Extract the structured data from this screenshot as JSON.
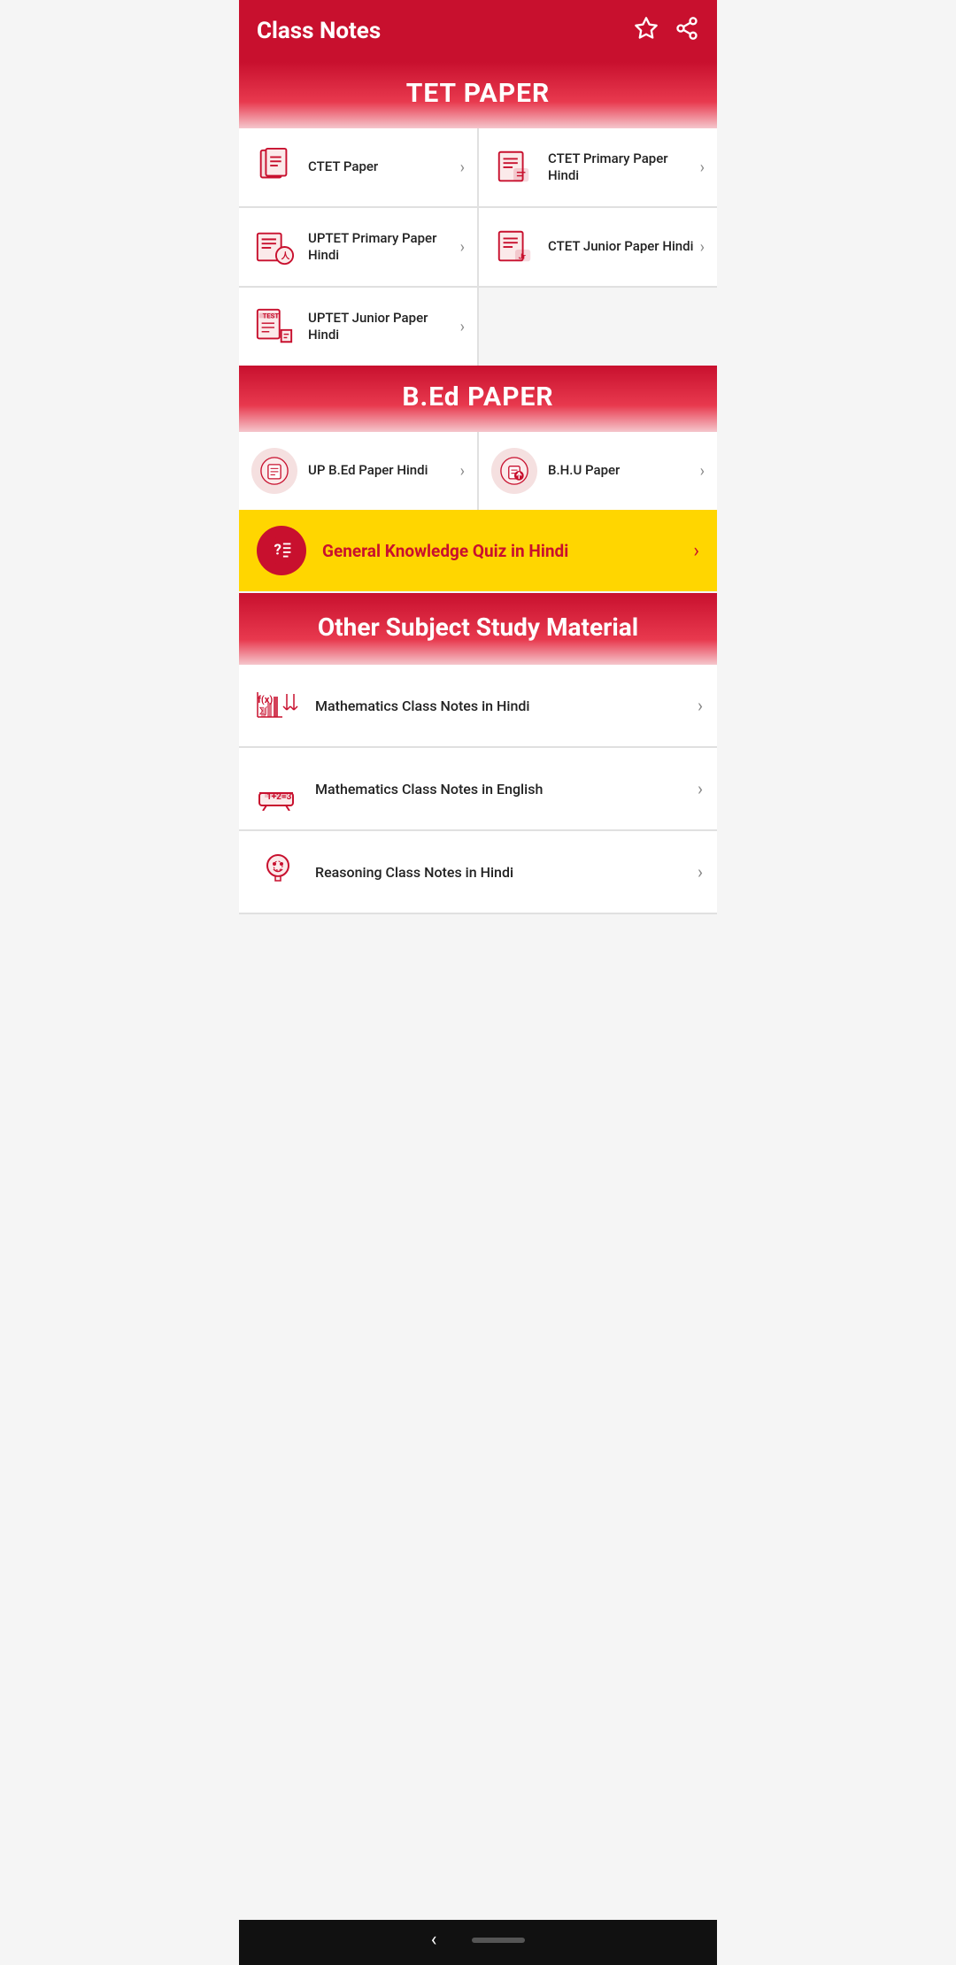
{
  "header": {
    "title": "Class Notes",
    "star_icon": "★",
    "share_icon": "share"
  },
  "tet_section": {
    "title": "TET PAPER",
    "items": [
      {
        "label": "CTET Paper",
        "icon": "ctet-paper-icon"
      },
      {
        "label": "CTET Primary Paper Hindi",
        "icon": "ctet-primary-icon"
      },
      {
        "label": "UPTET Primary Paper Hindi",
        "icon": "uptet-primary-icon"
      },
      {
        "label": "CTET Junior Paper Hindi",
        "icon": "ctet-junior-icon"
      },
      {
        "label": "UPTET Junior Paper Hindi",
        "icon": "uptet-junior-icon"
      }
    ]
  },
  "bed_section": {
    "title": "B.Ed PAPER",
    "items": [
      {
        "label": "UP B.Ed Paper Hindi",
        "icon": "up-bed-icon"
      },
      {
        "label": "B.H.U Paper",
        "icon": "bhu-icon"
      }
    ]
  },
  "quiz": {
    "label": "General Knowledge Quiz in Hindi",
    "icon": "quiz-icon"
  },
  "other_section": {
    "title": "Other Subject Study Material",
    "items": [
      {
        "label": "Mathematics Class Notes in Hindi",
        "icon": "math-hindi-icon"
      },
      {
        "label": "Mathematics Class Notes in English",
        "icon": "math-english-icon"
      },
      {
        "label": "Reasoning Class Notes in Hindi",
        "icon": "reasoning-icon"
      }
    ]
  },
  "bottom_bar": {
    "back_label": "‹"
  }
}
